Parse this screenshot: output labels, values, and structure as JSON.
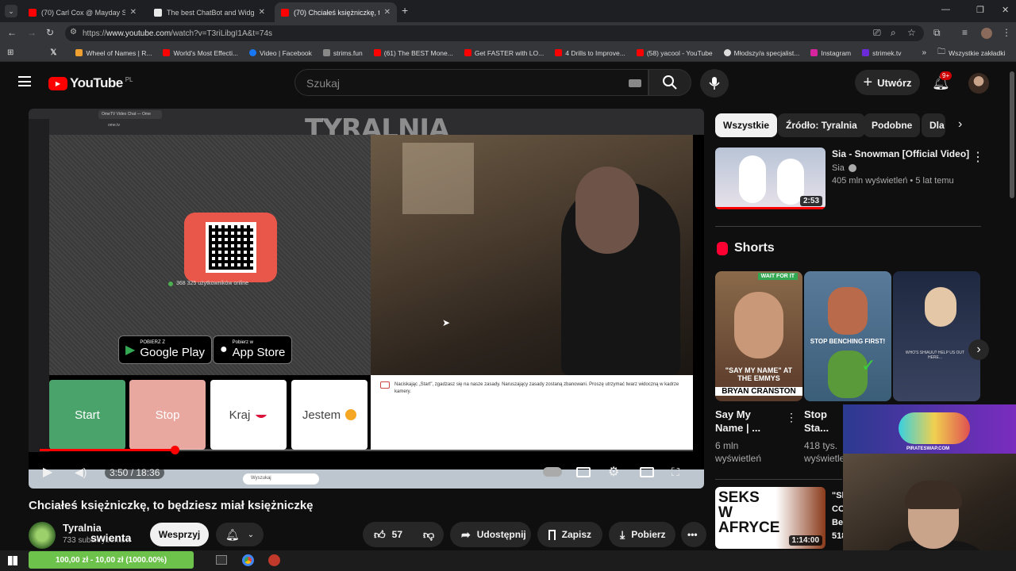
{
  "browser": {
    "tabs": [
      {
        "title": "(70) Carl Cox @ Mayday Sonic",
        "color": "#ff0000"
      },
      {
        "title": "The best ChatBot and Widgets",
        "color": "#e8e8e8"
      },
      {
        "title": "(70) Chciałeś księżniczkę, to bę",
        "color": "#ff0000"
      }
    ],
    "url_prefix": "https://",
    "url_host": "www.youtube.com",
    "url_path": "/watch?v=T3riLibgI1A&t=74s",
    "bookmarks": [
      {
        "label": "Wheel of Names | R...",
        "color": "#f0a030"
      },
      {
        "label": "World's Most Effecti...",
        "color": "#ff0000"
      },
      {
        "label": "Video | Facebook",
        "color": "#1877f2"
      },
      {
        "label": "strims.fun",
        "color": "#888888"
      },
      {
        "label": "(61) The BEST Mone...",
        "color": "#ff0000"
      },
      {
        "label": "Get FASTER with LO...",
        "color": "#ff0000"
      },
      {
        "label": "4 Drills to Improve...",
        "color": "#ff0000"
      },
      {
        "label": "(58) yacool - YouTube",
        "color": "#ff0000"
      },
      {
        "label": "Młodszy/a specjalist...",
        "color": "#dddddd"
      },
      {
        "label": "Instagram",
        "color": "#d6249f"
      },
      {
        "label": "strimek.tv",
        "color": "#6c2bd9"
      }
    ],
    "all_bookmarks": "Wszystkie zakładki"
  },
  "youtube": {
    "logo": "YouTube",
    "region": "PL",
    "search_placeholder": "Szukaj",
    "create_label": "Utwórz",
    "notif_badge": "9+"
  },
  "player": {
    "watermark": "TYRALNIA",
    "online_text": "368 325 użytkowników online",
    "google_small": "POBIERZ Z",
    "google_big": "Google Play",
    "apple_small": "Pobierz w",
    "apple_big": "App Store",
    "btn_start": "Start",
    "btn_stop": "Stop",
    "btn_country": "Kraj",
    "btn_gender": "Jestem",
    "terms_text": "Naciskając „Start\", zgadzasz się na nasze zasady. Naruszający zasady zostaną zbanowani. Proszę utrzymać twarz widoczną w kadrze kamery.",
    "inner_tab": "OmeTV Video Chat — Ome",
    "inner_url": "ome.tv",
    "inner_search": "Wyszukaj",
    "time": "3:50 / 18:36",
    "progress": 0.206
  },
  "video": {
    "title": "Chciałeś księżniczkę, to będziesz miał księżniczkę",
    "channel": "Tyralnia",
    "subs": "733 subskrybentów",
    "support": "Wesprzyj",
    "likes": "57",
    "share": "Udostępnij",
    "save": "Zapisz",
    "download": "Pobierz"
  },
  "sidebar": {
    "chips": [
      "Wszystkie",
      "Źródło: Tyralnia",
      "Podobne",
      "Dla"
    ],
    "rec_title": "Sia - Snowman [Official Video]",
    "rec_channel": "Sia",
    "rec_meta": "405 mln wyświetleń • 5 lat temu",
    "rec_duration": "2:53",
    "shorts_heading": "Shorts",
    "shorts": [
      {
        "title": "Say My Name | ...",
        "views": "6 mln wyświetleń",
        "caption": "\"SAY MY NAME\" AT THE EMMYS",
        "sub": "BRYAN CRANSTON",
        "top": "WAIT FOR IT",
        "bg": "#7a5a3a"
      },
      {
        "title": "Stop Sta... With Ben...",
        "views": "418 tys. wyświetleń",
        "caption": "STOP BENCHING FIRST!",
        "sub": "",
        "top": "",
        "bg": "#3d6b8a"
      },
      {
        "title": "",
        "views": "",
        "caption": "WHO'S SHIAUU? HELP US OUT HERE...",
        "sub": "",
        "top": "",
        "bg": "#2a3550"
      }
    ],
    "rec2_title": "SEKS W AFRYCE",
    "rec2_duration": "1:14:00",
    "rec2_side": "\"Sl CO Bez 518"
  },
  "overlay": {
    "donation": "100,00 zł - 10,00 zł (1000.00%)",
    "stream_name": "swienta",
    "ad_text": "PIRATESWAP.COM"
  }
}
